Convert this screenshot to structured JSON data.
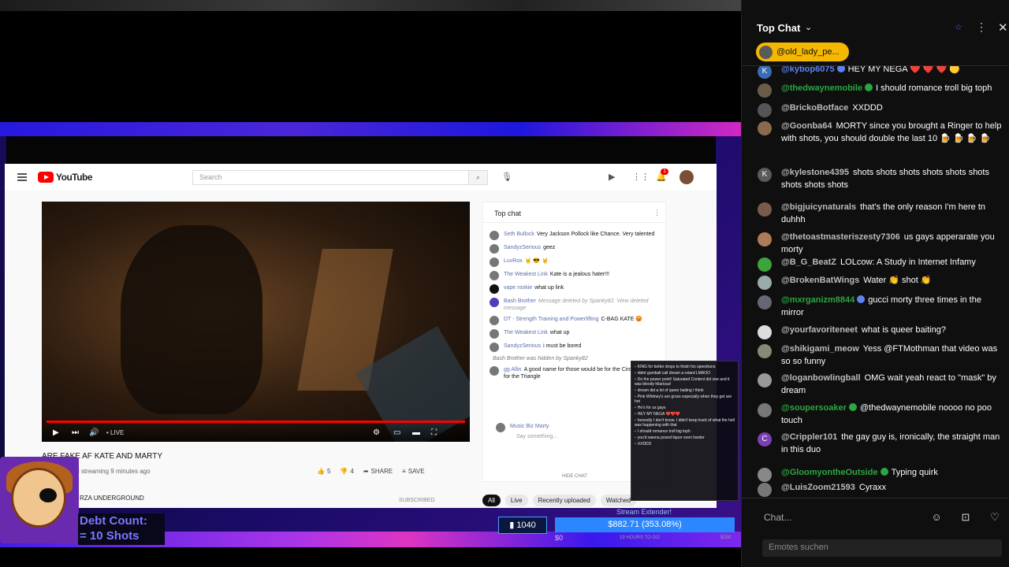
{
  "outer_chat": {
    "title": "Top Chat",
    "pinned_user": "@old_lady_pe...",
    "messages": [
      {
        "author": "@kybop6075",
        "text": "HEY MY NEGA ❤️ ❤️ ❤️ 🟡",
        "avatar_letter": "K",
        "avatar_color": "#3a6cb5",
        "name_color": "b",
        "badge": "b"
      },
      {
        "author": "@thedwaynemobile",
        "text": "I should romance troll big toph",
        "avatar_letter": "",
        "avatar_color": "#6b5b4b",
        "name_color": "g",
        "badge": "g"
      },
      {
        "author": "@BrickoBotface",
        "text": "XXDDD",
        "avatar_letter": "",
        "avatar_color": "#555",
        "name_color": "n",
        "badge": ""
      },
      {
        "author": "@Goonba64",
        "text": "MORTY since you brought a Ringer to help with shots, you should double the last 10 🍺 🍺 🍺 🍺",
        "avatar_letter": "",
        "avatar_color": "#8a6a4a",
        "name_color": "n",
        "badge": ""
      },
      {
        "author": "@kylestone4395",
        "text": "shots shots shots shots shots shots shots shots shots",
        "avatar_letter": "K",
        "avatar_color": "#5a5a5a",
        "name_color": "n",
        "badge": ""
      },
      {
        "author": "@bigjuicynaturals",
        "text": "that's the only reason I'm here tn duhhh",
        "avatar_letter": "",
        "avatar_color": "#7a5a4a",
        "name_color": "n",
        "badge": ""
      },
      {
        "author": "@thetoastmasteriszesty7306",
        "text": "us gays apperarate you morty",
        "avatar_letter": "",
        "avatar_color": "#b07a5a",
        "name_color": "n",
        "badge": ""
      },
      {
        "author": "@B_G_BeatZ",
        "text": "LOLcow: A Study in Internet Infamy",
        "avatar_letter": "",
        "avatar_color": "#3da33d",
        "name_color": "n",
        "badge": ""
      },
      {
        "author": "@BrokenBatWings",
        "text": "Water 👏 shot 👏",
        "avatar_letter": "",
        "avatar_color": "#9aa",
        "name_color": "n",
        "badge": ""
      },
      {
        "author": "@mxrganizm8844",
        "text": "gucci morty three times in the mirror",
        "avatar_letter": "",
        "avatar_color": "#667",
        "name_color": "g",
        "badge": "b"
      },
      {
        "author": "@yourfavoriteneet",
        "text": "what is queer baiting?",
        "avatar_letter": "",
        "avatar_color": "#ddd",
        "name_color": "n",
        "badge": ""
      },
      {
        "author": "@shikigami_meow",
        "text": "Yess @FTMothman that video was so so funny",
        "avatar_letter": "",
        "avatar_color": "#887",
        "name_color": "n",
        "badge": ""
      },
      {
        "author": "@loganbowlingball",
        "text": "OMG wait yeah react to \"mask\" by dream",
        "avatar_letter": "",
        "avatar_color": "#999",
        "name_color": "n",
        "badge": ""
      },
      {
        "author": "@soupersoaker",
        "text": "@thedwaynemobile noooo no poo touch",
        "avatar_letter": "",
        "avatar_color": "#777",
        "name_color": "g",
        "badge": "g"
      },
      {
        "author": "@Crippler101",
        "text": "the gay guy is, ironically, the straight man in this duo",
        "avatar_letter": "C",
        "avatar_color": "#7a3fb5",
        "name_color": "n",
        "badge": ""
      },
      {
        "author": "@GloomyontheOutside",
        "text": "Typing quirk",
        "avatar_letter": "",
        "avatar_color": "#888",
        "name_color": "g",
        "badge": "g"
      },
      {
        "author": "@LuisZoom21593",
        "text": "Cyraxx",
        "avatar_letter": "",
        "avatar_color": "#777",
        "name_color": "n",
        "badge": ""
      }
    ],
    "input_placeholder": "Chat...",
    "emote_search_placeholder": "Emotes suchen",
    "icons": {
      "star": "star-icon",
      "more": "more-vert-icon",
      "close": "close-icon",
      "emoji": "emoji-icon",
      "gift": "gift-icon",
      "heart": "heart-icon"
    }
  },
  "inner_youtube": {
    "logo": "YouTube",
    "search_placeholder": "Search",
    "notification_count": "1",
    "video_title": "ARE FAKE AF KATE AND MARTY",
    "video_meta": "now • Started streaming 9 minutes ago",
    "live_label": "• LIVE",
    "likes": "5",
    "dislikes": "4",
    "share": "SHARE",
    "save": "SAVE",
    "channel": "RZA UNDERGROUND",
    "subscribed": "SUBSCRIBED",
    "chips": [
      "All",
      "Live",
      "Recently uploaded",
      "Watched"
    ],
    "chat_title": "Top chat",
    "chat_messages": [
      {
        "author": "Seth Bullock",
        "text": "Very Jackson Pollock like Chance. Very talented"
      },
      {
        "author": "SandyzSerious",
        "text": "geez"
      },
      {
        "author": "LuvRox",
        "text": "🤘 😎 🤘"
      },
      {
        "author": "The Weakest Link",
        "text": "Kate is a jealous hater!!!"
      },
      {
        "author": "vape rookie",
        "text": "what up link"
      },
      {
        "author": "Bash Brother",
        "text": "Message deleted by Spanky82. View deleted message"
      },
      {
        "author": "DT - Strength Training and Powerlifting",
        "text": "C-BAG KATE 😡"
      },
      {
        "author": "The Weakest Link",
        "text": "what up"
      },
      {
        "author": "SandyzSerious",
        "text": "i must be bored"
      }
    ],
    "chat_note": "Bash Brother was hidden by Spanky82",
    "chat_msg_last": {
      "author": "gg Allin",
      "text": "A good name for those would be for the Circle , and Run for the Triangle"
    },
    "chat_user": "Music Biz Marty",
    "say_something": "Say something...",
    "hide_chat": "HIDE CHAT"
  },
  "mini_chat": [
    {
      "u": "",
      "t": "KING for better drops to finish his speedruns"
    },
    {
      "u": "",
      "t": "didnt gumball call dream a retard LMAOO"
    },
    {
      "u": "",
      "t": "Do the power point! Saturated Content did one and it was bloody hilarious!"
    },
    {
      "u": "",
      "t": "dream did a lot of queer baiting I think"
    },
    {
      "u": "",
      "t": "Pink Whitney's are gross especially when they get are hot"
    },
    {
      "u": "",
      "t": "He's for us gays"
    },
    {
      "u": "",
      "t": "HEY MY NEGA ❤️❤️❤️"
    },
    {
      "u": "",
      "t": "honestly I don't know. I didn't keep track of what the hell was happening with that"
    },
    {
      "u": "",
      "t": "I should romance troll big toph"
    },
    {
      "u": "",
      "t": "you'd wanna pound liquor even harder"
    },
    {
      "u": "",
      "t": "XXDDD"
    }
  ],
  "overlay": {
    "debt_line1": "Debt Count:",
    "debt_line2": "= 10 Shots",
    "stream_extender": "Stream Extender!",
    "bits": "1040",
    "goal_text": "$882.71 (353.08%)",
    "goal_progress": 1.0,
    "goal_min": "$0",
    "goal_mid": "19 HOURS TO GO",
    "goal_max": "$250"
  }
}
